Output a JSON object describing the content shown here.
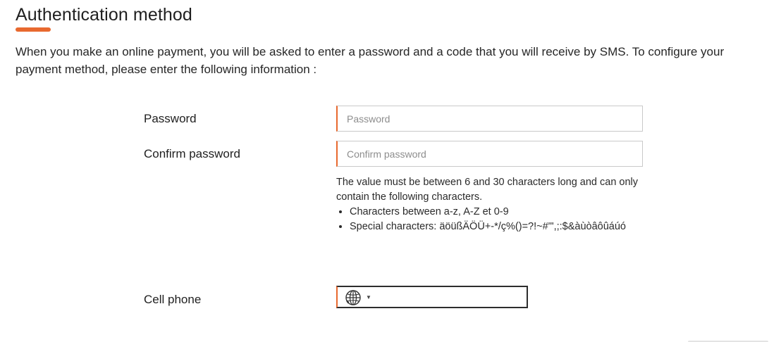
{
  "section": {
    "title": "Authentication method",
    "intro": "When you make an online payment, you will be asked to enter a password and a code that you will receive by SMS. To configure your payment method, please enter the following information :"
  },
  "form": {
    "password": {
      "label": "Password",
      "placeholder": "Password",
      "value": ""
    },
    "confirm_password": {
      "label": "Confirm password",
      "placeholder": "Confirm password",
      "value": ""
    },
    "hint": {
      "text": "The value must be between 6 and 30 characters long and can only contain the following characters.",
      "rules": [
        "Characters between a-z, A-Z et 0-9",
        "Special characters: äöüßÄÖÜ+-*/ç%()=?!~#'\",;:$&àùòâôûáúó"
      ]
    },
    "cell_phone": {
      "label": "Cell phone",
      "country_icon": "globe-icon",
      "dropdown_icon": "caret-down-icon",
      "value": ""
    }
  },
  "colors": {
    "accent": "#e8692f",
    "border": "#c9c9c9",
    "text": "#222222"
  }
}
